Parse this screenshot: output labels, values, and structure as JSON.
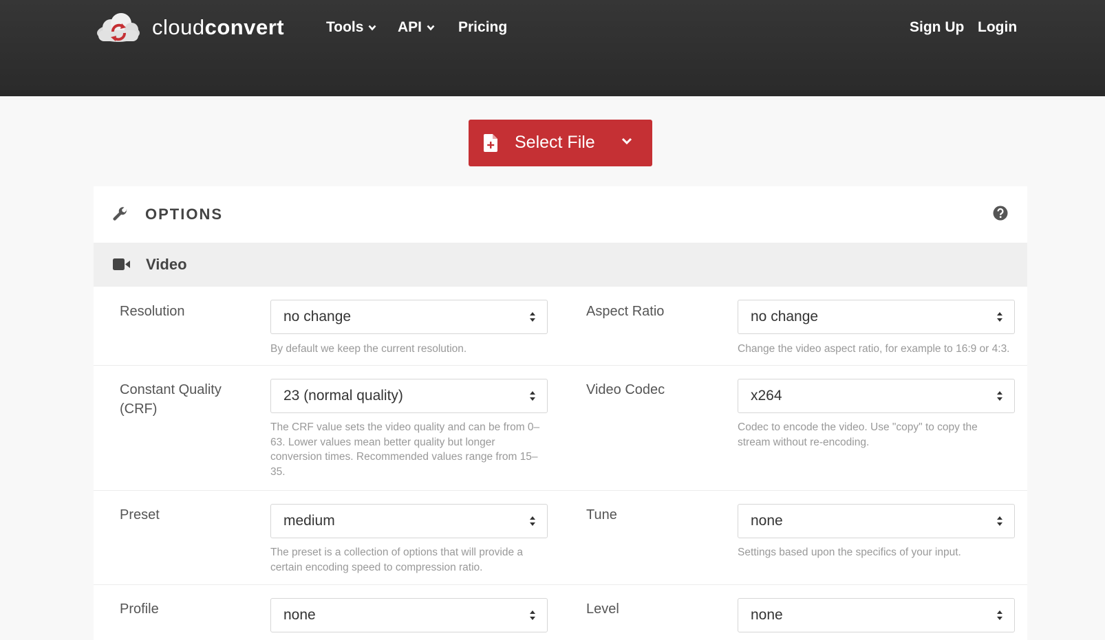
{
  "header": {
    "brand_light": "cloud",
    "brand_bold": "convert",
    "nav": {
      "tools": "Tools",
      "api": "API",
      "pricing": "Pricing",
      "signup": "Sign Up",
      "login": "Login"
    }
  },
  "upload": {
    "select_label": "Select File"
  },
  "options": {
    "title": "OPTIONS",
    "section_title": "Video",
    "fields": {
      "resolution": {
        "label": "Resolution",
        "value": "no change",
        "help": "By default we keep the current resolution."
      },
      "aspect_ratio": {
        "label": "Aspect Ratio",
        "value": "no change",
        "help": "Change the video aspect ratio, for example to 16:9 or 4:3."
      },
      "crf": {
        "label": "Constant Quality (CRF)",
        "value": "23 (normal quality)",
        "help": "The CRF value sets the video quality and can be from 0–63. Lower values mean better quality but longer conversion times. Recommended values range from 15–35."
      },
      "codec": {
        "label": "Video Codec",
        "value": "x264",
        "help": "Codec to encode the video. Use \"copy\" to copy the stream without re-encoding."
      },
      "preset": {
        "label": "Preset",
        "value": "medium",
        "help": "The preset is a collection of options that will provide a certain encoding speed to compression ratio."
      },
      "tune": {
        "label": "Tune",
        "value": "none",
        "help": "Settings based upon the specifics of your input."
      },
      "profile": {
        "label": "Profile",
        "value": "none"
      },
      "level": {
        "label": "Level",
        "value": "none"
      }
    }
  },
  "colors": {
    "header_bg": "#2e2e2e",
    "accent_red": "#c53034",
    "section_bg": "#efefef"
  },
  "icons": [
    "cloud-logo-icon",
    "chevron-down-icon",
    "file-plus-icon",
    "wrench-icon",
    "help-circle-icon",
    "video-camera-icon",
    "select-arrows-icon"
  ]
}
